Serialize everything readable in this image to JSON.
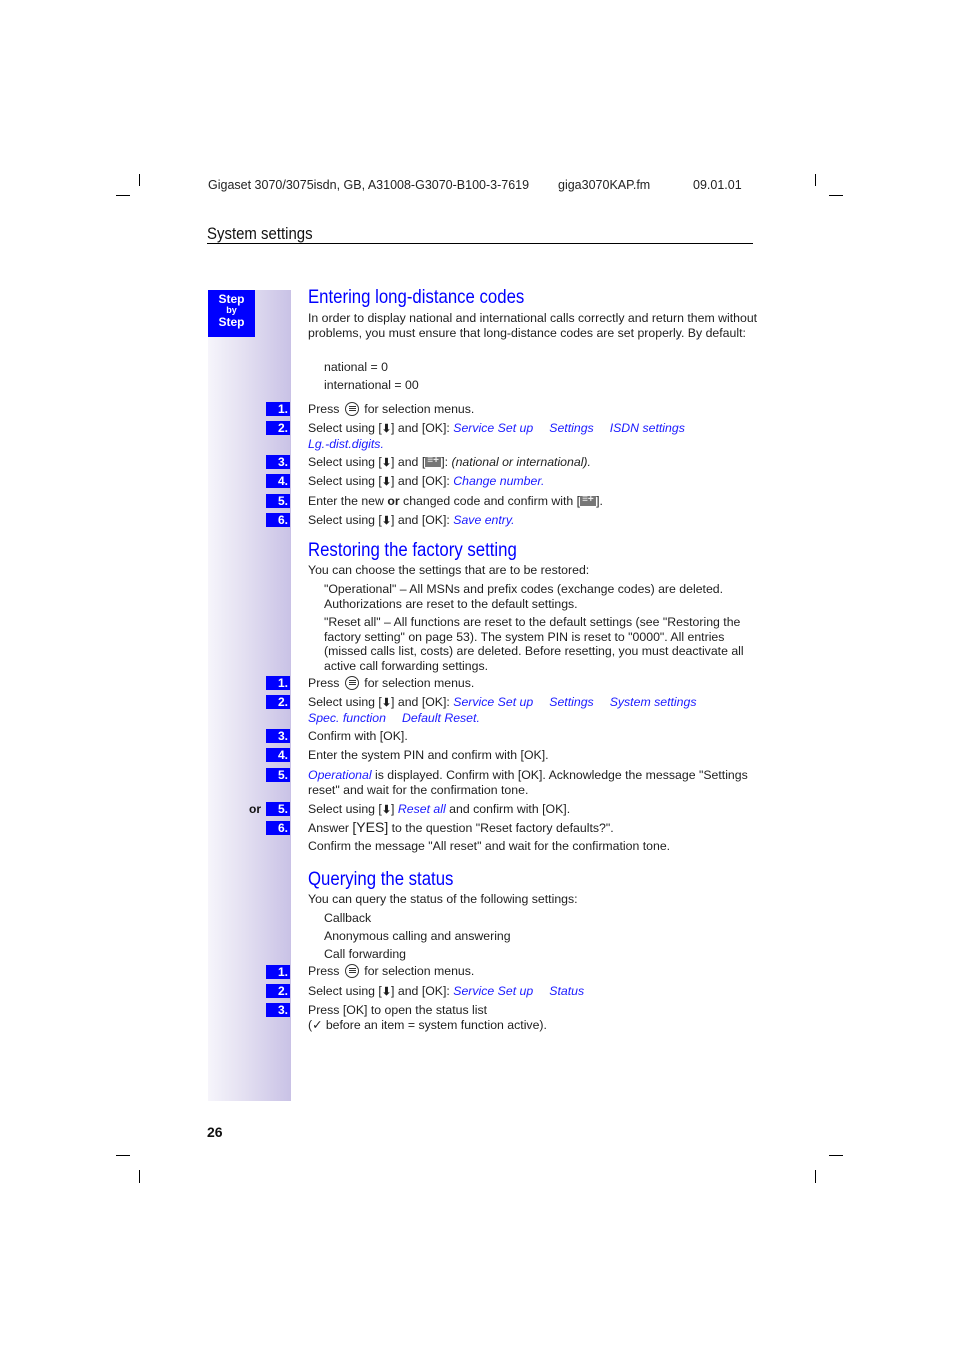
{
  "header": {
    "doc_id": "Gigaset 3070/3075isdn, GB, A31008-G3070-B100-3-7619",
    "file_name": "giga3070KAP.fm",
    "date": "09.01.01",
    "section": "System settings"
  },
  "sidebar": {
    "step_label_1": "Step",
    "step_label_2": "by",
    "step_label_3": "Step"
  },
  "colors": {
    "accent": "#0000ff",
    "link_text": "#1a1aff",
    "sidebar_gradient_end": "#c9c2e6"
  },
  "section1": {
    "title": "Entering long-distance codes",
    "intro": "In order to display national and international calls correctly and return them without problems, you must ensure that long-distance codes are set properly. By default:",
    "defaults": [
      "national = 0",
      "international = 00"
    ],
    "steps": [
      {
        "num": "1.",
        "pre": "Press",
        "icon": "menu-icon",
        "post": "for selection menus."
      },
      {
        "num": "2.",
        "pre": "Select using [",
        "icon": "arrow-down-icon",
        "mid": "] and [OK]:",
        "path": [
          "Service Set up",
          "Settings",
          "ISDN settings",
          "Lg.-dist.digits"
        ],
        "end": "."
      },
      {
        "num": "3.",
        "pre": "Select using [",
        "icon": "arrow-down-icon",
        "mid": "] and [",
        "icon2": "key-icon",
        "mid2": "]:",
        "note": "(national or international)",
        "end": "."
      },
      {
        "num": "4.",
        "pre": "Select using [",
        "icon": "arrow-down-icon",
        "mid": "] and [OK]:",
        "path": [
          "Change number"
        ],
        "end": "."
      },
      {
        "num": "5.",
        "pre": "Enter the new",
        "bold": "or",
        "post": "changed code and confirm with [",
        "icon": "key-icon",
        "end": "]."
      },
      {
        "num": "6.",
        "pre": "Select using [",
        "icon": "arrow-down-icon",
        "mid": "] and [OK]:",
        "path": [
          "Save entry"
        ],
        "end": "."
      }
    ]
  },
  "section2": {
    "title": "Restoring the factory setting",
    "intro": "You can choose the settings that are to be restored:",
    "options": [
      {
        "name": "\"Operational\"",
        "text": " – All MSNs and prefix codes (exchange codes) are deleted. Authorizations are reset to the default settings."
      },
      {
        "name": "\"Reset all\"",
        "text": " – All functions are reset to the default settings (see \"Restoring the factory setting\" on page 53). The system PIN is reset to \"0000\". All entries (missed calls list, costs) are deleted. Before resetting, you must deactivate all active call forwarding settings."
      }
    ],
    "steps": [
      {
        "num": "1.",
        "pre": "Press",
        "post": "for selection menus."
      },
      {
        "num": "2.",
        "pre": "Select using [",
        "mid": "] and [OK]:",
        "path": [
          "Service Set up",
          "Settings",
          "System settings",
          "Spec. function",
          "Default Reset"
        ],
        "end": "."
      },
      {
        "num": "3.",
        "text": "Confirm with [OK]."
      },
      {
        "num": "4.",
        "text": "Enter the system PIN and confirm with [OK]."
      },
      {
        "num": "5.",
        "link": "Operational",
        "text": " is displayed. Confirm with [OK]. Acknowledge the message \"Settings reset\" and wait for the confirmation tone."
      },
      {
        "prefix": "or",
        "num": "5.",
        "pre": "Select using [",
        "mid": "]",
        "link": "Reset all",
        "text": " and confirm with [OK]."
      },
      {
        "num": "6.",
        "pre": "Answer ",
        "key": "[YES]",
        "text": " to the question \"Reset factory defaults?\"."
      },
      {
        "text": "Confirm the message \"All reset\" and wait for the confirmation tone."
      }
    ]
  },
  "section3": {
    "title": "Querying the status",
    "intro": "You can query the status of the following settings:",
    "items": [
      "Callback",
      "Anonymous calling and answering",
      "Call forwarding"
    ],
    "steps": [
      {
        "num": "1.",
        "pre": "Press",
        "post": "for selection menus."
      },
      {
        "num": "2.",
        "pre": "Select using [",
        "mid": "] and [OK]:",
        "path": [
          "Service Set up",
          "Status"
        ]
      },
      {
        "num": "3.",
        "line1": "Press [OK] to open the status list",
        "line2": "(✓ before an item = system function active)."
      }
    ]
  },
  "footer": {
    "page_number": "26"
  }
}
